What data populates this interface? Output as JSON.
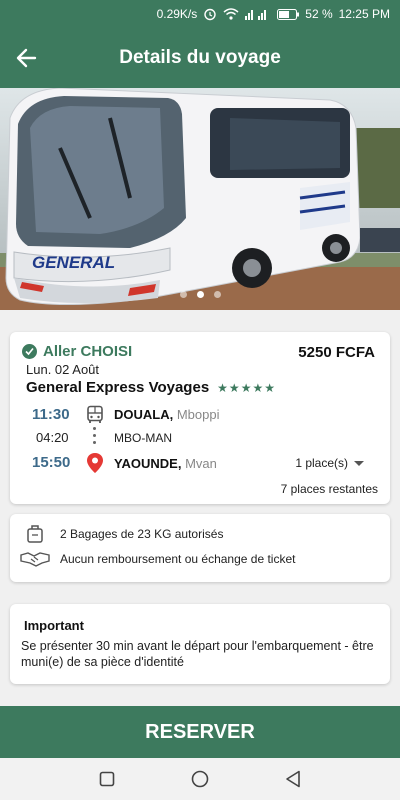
{
  "status_bar": {
    "speed": "0.29K/s",
    "battery": "52 %",
    "time": "12:25 PM"
  },
  "header": {
    "title": "Details du voyage"
  },
  "hero": {
    "bus_brand": "GENERAL",
    "slide_count": 3,
    "active_slide": 1
  },
  "trip": {
    "status": "Aller CHOISI",
    "price": "5250 FCFA",
    "date": "Lun. 02 Août",
    "company": "General Express Voyages",
    "rating": "★★★★★",
    "departure": {
      "time": "11:30",
      "city": "DOUALA,",
      "area": "Mboppi"
    },
    "stop": {
      "time": "04:20",
      "name": "MBO-MAN"
    },
    "arrival": {
      "time": "15:50",
      "city": "YAOUNDE,",
      "area": "Mvan"
    },
    "places_selector": "1 place(s)",
    "remaining": "7 places restantes"
  },
  "baggage": {
    "allowance": "2 Bagages de 23 KG autorisés",
    "refund": "Aucun remboursement ou échange de ticket"
  },
  "important": {
    "title": "Important",
    "text": "Se présenter 30 min avant le départ pour l'embarquement - être muni(e) de sa pièce d'identité"
  },
  "actions": {
    "reserve_label": "RESERVER"
  },
  "colors": {
    "primary": "#3d7a5e",
    "time_blue": "#3d6a8a",
    "pin_red": "#e53935"
  }
}
